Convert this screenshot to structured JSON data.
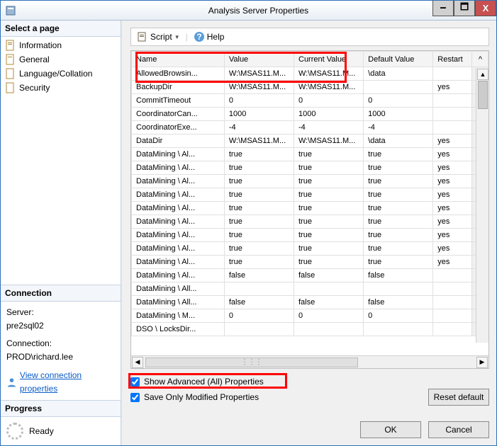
{
  "window": {
    "title": "Analysis Server Properties"
  },
  "titlebar_buttons": {
    "min": "🗕",
    "max": "🗖",
    "close": "X"
  },
  "left": {
    "select_page": "Select a page",
    "nav": [
      "Information",
      "General",
      "Language/Collation",
      "Security"
    ],
    "connection_hdr": "Connection",
    "server_lbl": "Server:",
    "server_val": "pre2sql02",
    "conn_lbl": "Connection:",
    "conn_val": "PROD\\richard.lee",
    "view_conn": "View connection properties",
    "progress_hdr": "Progress",
    "progress_val": "Ready"
  },
  "toolbar": {
    "script": "Script",
    "help": "Help"
  },
  "grid": {
    "headers": [
      "Name",
      "Value",
      "Current Value",
      "Default Value",
      "Restart"
    ],
    "rows": [
      {
        "name": "AllowedBrowsin...",
        "value": "W:\\MSAS11.M...",
        "current": "W:\\MSAS11.M...",
        "def": "\\data",
        "restart": ""
      },
      {
        "name": "BackupDir",
        "value": "W:\\MSAS11.M...",
        "current": "W:\\MSAS11.M...",
        "def": "",
        "restart": "yes"
      },
      {
        "name": "CommitTimeout",
        "value": "0",
        "current": "0",
        "def": "0",
        "restart": ""
      },
      {
        "name": "CoordinatorCan...",
        "value": "1000",
        "current": "1000",
        "def": "1000",
        "restart": ""
      },
      {
        "name": "CoordinatorExe...",
        "value": "-4",
        "current": "-4",
        "def": "-4",
        "restart": ""
      },
      {
        "name": "DataDir",
        "value": "W:\\MSAS11.M...",
        "current": "W:\\MSAS11.M...",
        "def": "\\data",
        "restart": "yes"
      },
      {
        "name": "DataMining \\ Al...",
        "value": "true",
        "current": "true",
        "def": "true",
        "restart": "yes"
      },
      {
        "name": "DataMining \\ Al...",
        "value": "true",
        "current": "true",
        "def": "true",
        "restart": "yes"
      },
      {
        "name": "DataMining \\ Al...",
        "value": "true",
        "current": "true",
        "def": "true",
        "restart": "yes"
      },
      {
        "name": "DataMining \\ Al...",
        "value": "true",
        "current": "true",
        "def": "true",
        "restart": "yes"
      },
      {
        "name": "DataMining \\ Al...",
        "value": "true",
        "current": "true",
        "def": "true",
        "restart": "yes"
      },
      {
        "name": "DataMining \\ Al...",
        "value": "true",
        "current": "true",
        "def": "true",
        "restart": "yes"
      },
      {
        "name": "DataMining \\ Al...",
        "value": "true",
        "current": "true",
        "def": "true",
        "restart": "yes"
      },
      {
        "name": "DataMining \\ Al...",
        "value": "true",
        "current": "true",
        "def": "true",
        "restart": "yes"
      },
      {
        "name": "DataMining \\ Al...",
        "value": "true",
        "current": "true",
        "def": "true",
        "restart": "yes"
      },
      {
        "name": "DataMining \\ Al...",
        "value": "false",
        "current": "false",
        "def": "false",
        "restart": ""
      },
      {
        "name": "DataMining \\ All...",
        "value": "",
        "current": "",
        "def": "",
        "restart": ""
      },
      {
        "name": "DataMining \\ All...",
        "value": "false",
        "current": "false",
        "def": "false",
        "restart": ""
      },
      {
        "name": "DataMining \\ M...",
        "value": "0",
        "current": "0",
        "def": "0",
        "restart": ""
      },
      {
        "name": "DSO \\ LocksDir...",
        "value": "",
        "current": "",
        "def": "",
        "restart": ""
      }
    ]
  },
  "options": {
    "advanced": "Show Advanced (All) Properties",
    "saveonly": "Save Only Modified Properties"
  },
  "buttons": {
    "reset": "Reset default",
    "ok": "OK",
    "cancel": "Cancel"
  }
}
